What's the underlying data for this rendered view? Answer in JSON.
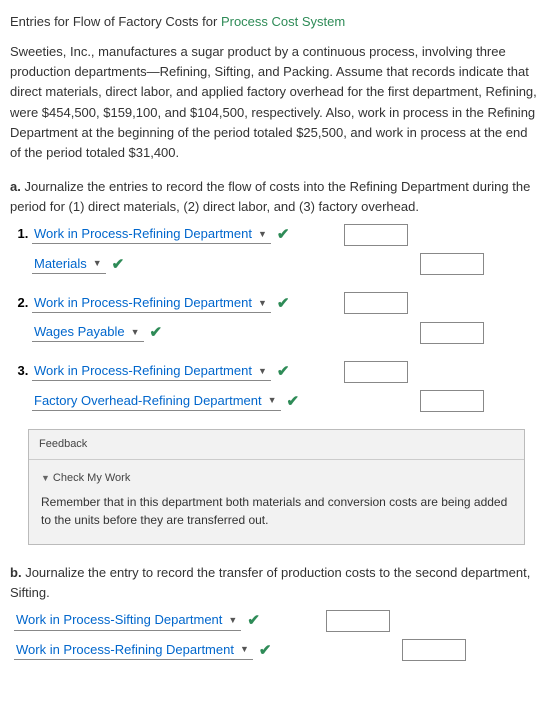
{
  "title_prefix": "Entries for Flow of Factory Costs for ",
  "title_green": "Process Cost System",
  "intro": "Sweeties, Inc., manufactures a sugar product by a continuous process, involving three production departments—Refining, Sifting, and Packing. Assume that records indicate that direct materials, direct labor, and applied factory overhead for the first department, Refining, were $454,500, $159,100, and $104,500, respectively. Also, work in process in the Refining Department at the beginning of the period totaled $25,500, and work in process at the end of the period totaled $31,400.",
  "partA": {
    "letter": "a.",
    "text": "Journalize the entries to record the flow of costs into the Refining Department during the period for (1) direct materials, (2) direct labor, and (3) factory overhead.",
    "entries": [
      {
        "debit_account": "Work in Process-Refining Department",
        "credit_account": "Materials"
      },
      {
        "debit_account": "Work in Process-Refining Department",
        "credit_account": "Wages Payable"
      },
      {
        "debit_account": "Work in Process-Refining Department",
        "credit_account": "Factory Overhead-Refining Department"
      }
    ]
  },
  "feedback": {
    "header": "Feedback",
    "check_label": "Check My Work",
    "hint": "Remember that in this department both materials and conversion costs are being added to the units before they are transferred out."
  },
  "partB": {
    "letter": "b.",
    "text": "Journalize the entry to record the transfer of production costs to the second department, Sifting.",
    "debit_account": "Work in Process-Sifting Department",
    "credit_account": "Work in Process-Refining Department"
  },
  "icons": {
    "dropdown_triangle": "▼",
    "checkmark": "✔"
  }
}
